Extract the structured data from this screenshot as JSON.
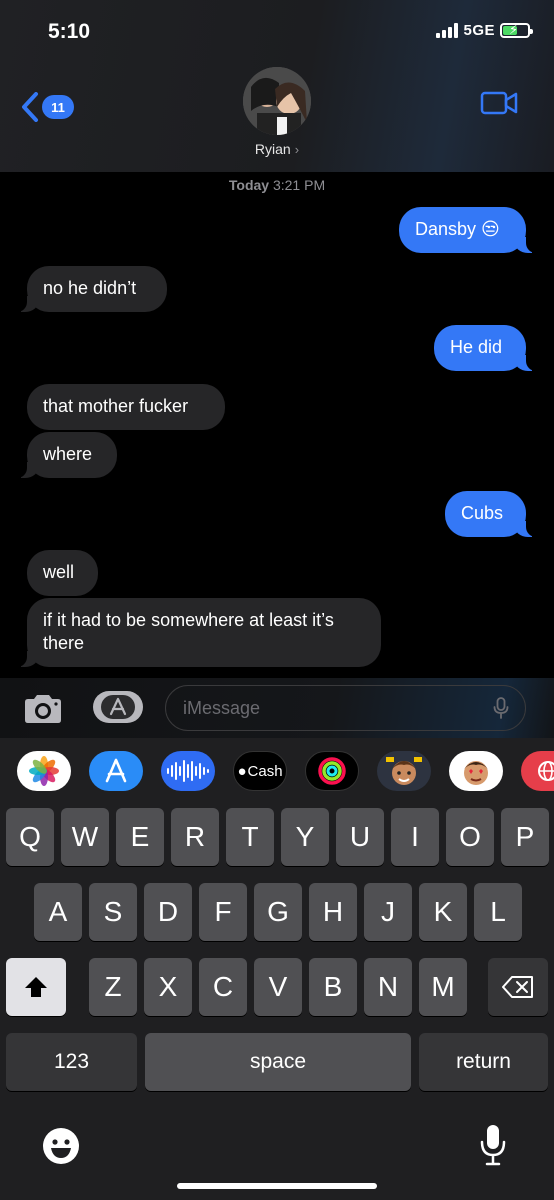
{
  "status": {
    "time": "5:10",
    "network": "5GE"
  },
  "header": {
    "back_count": "11",
    "contact_name": "Ryian",
    "chevron": "›"
  },
  "conversation": {
    "timestamp_day": "Today",
    "timestamp_time": "3:21 PM",
    "messages": [
      {
        "from": "me",
        "text": "Dansby 😒"
      },
      {
        "from": "them",
        "text": "no he didn’t"
      },
      {
        "from": "me",
        "text": "He did"
      },
      {
        "from": "them",
        "text": "that mother fucker"
      },
      {
        "from": "them",
        "text": "where"
      },
      {
        "from": "me",
        "text": "Cubs"
      },
      {
        "from": "them",
        "text": "well"
      },
      {
        "from": "them",
        "text": "if it had to be somewhere at least it’s there"
      }
    ]
  },
  "composer": {
    "placeholder": "iMessage"
  },
  "app_drawer": [
    {
      "name": "photos-app",
      "label": ""
    },
    {
      "name": "app-store-app",
      "label": ""
    },
    {
      "name": "audio-app",
      "label": ""
    },
    {
      "name": "apple-cash-app",
      "label": "Cash"
    },
    {
      "name": "activity-app",
      "label": ""
    },
    {
      "name": "memoji-app",
      "label": ""
    },
    {
      "name": "memoji-stickers-app",
      "label": ""
    },
    {
      "name": "web-images-app",
      "label": ""
    }
  ],
  "keyboard": {
    "row1": [
      "Q",
      "W",
      "E",
      "R",
      "T",
      "Y",
      "U",
      "I",
      "O",
      "P"
    ],
    "row2": [
      "A",
      "S",
      "D",
      "F",
      "G",
      "H",
      "J",
      "K",
      "L"
    ],
    "row3": [
      "Z",
      "X",
      "C",
      "V",
      "B",
      "N",
      "M"
    ],
    "numbers_label": "123",
    "space_label": "space",
    "return_label": "return"
  },
  "colors": {
    "outgoing": "#3478f6",
    "incoming": "#262628",
    "accent": "#3478f6"
  }
}
